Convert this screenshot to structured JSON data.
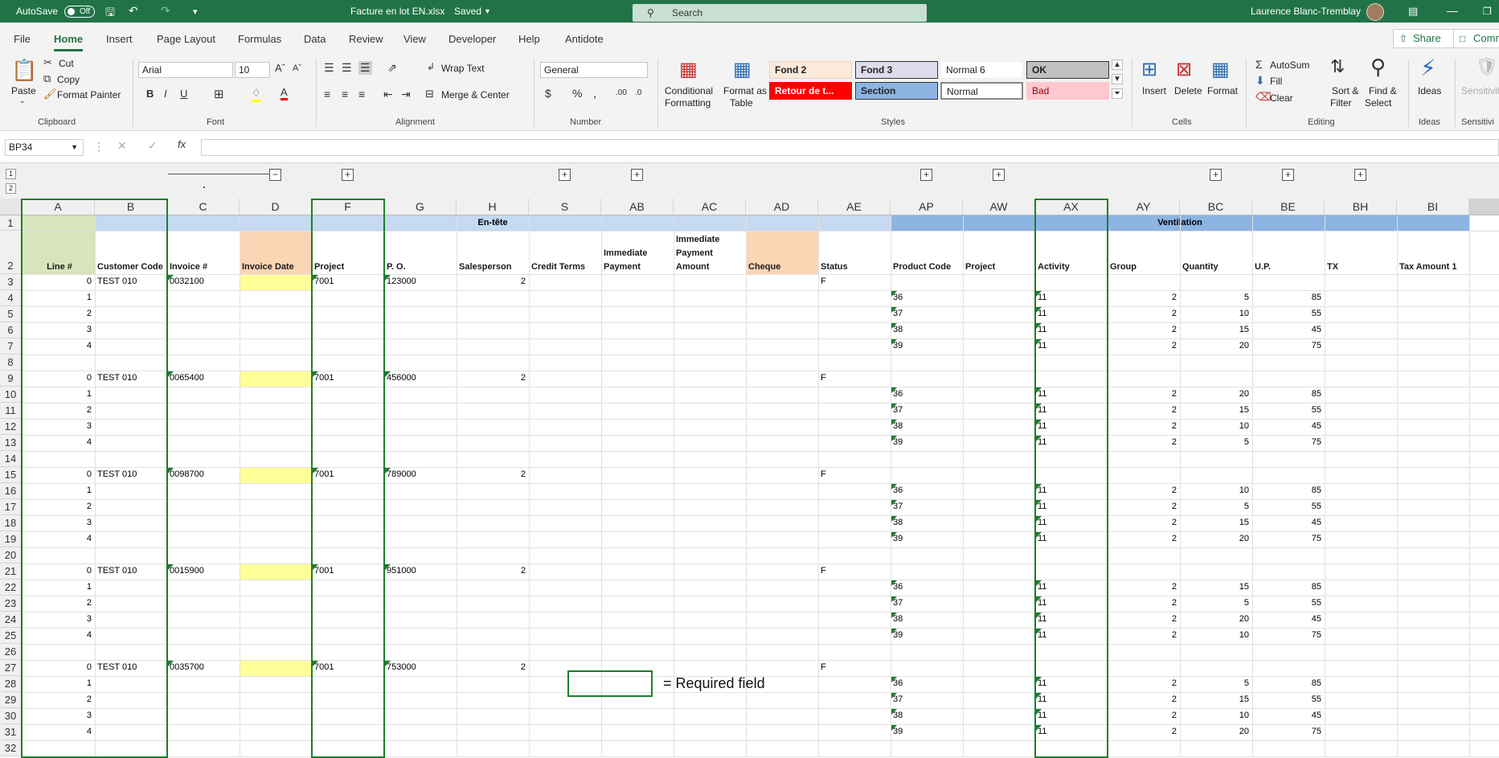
{
  "titlebar": {
    "autosave_label": "AutoSave",
    "autosave_state": "Off",
    "file": "Facture en lot EN.xlsx",
    "file_status": "Saved",
    "search_placeholder": "Search",
    "user": "Laurence Blanc-Tremblay"
  },
  "tabs": [
    "File",
    "Home",
    "Insert",
    "Page Layout",
    "Formulas",
    "Data",
    "Review",
    "View",
    "Developer",
    "Help",
    "Antidote"
  ],
  "share_label": "Share",
  "comments_label": "Comm",
  "ribbon": {
    "paste": "Paste",
    "cut": "Cut",
    "copy": "Copy",
    "format_painter": "Format Painter",
    "clipboard": "Clipboard",
    "font_name": "Arial",
    "font_size": "10",
    "font_group": "Font",
    "wrap_text": "Wrap Text",
    "merge_center": "Merge & Center",
    "alignment": "Alignment",
    "number_format": "General",
    "number_group": "Number",
    "cond_format_1": "Conditional",
    "cond_format_2": "Formatting",
    "format_table_1": "Format as",
    "format_table_2": "Table",
    "styles": "Styles",
    "style_items": [
      "Fond 2",
      "Fond 3",
      "Normal 6",
      "OK",
      "Retour de t...",
      "Section",
      "Normal",
      "Bad"
    ],
    "insert": "Insert",
    "delete": "Delete",
    "format": "Format",
    "cells": "Cells",
    "autosum": "AutoSum",
    "fill": "Fill",
    "clear": "Clear",
    "sort_filter_1": "Sort &",
    "sort_filter_2": "Filter",
    "find_select_1": "Find &",
    "find_select_2": "Select",
    "editing": "Editing",
    "ideas": "Ideas",
    "ideas_group": "Ideas",
    "sensitivity": "Sensitivit",
    "sensitivity_group": "Sensitivi"
  },
  "formula_bar": {
    "name_box": "BP34",
    "formula": ""
  },
  "outline_levels": [
    "1",
    "2"
  ],
  "columns": [
    "A",
    "B",
    "C",
    "D",
    "F",
    "G",
    "H",
    "S",
    "AB",
    "AC",
    "AD",
    "AE",
    "AP",
    "AW",
    "AX",
    "AY",
    "BC",
    "BE",
    "BH",
    "BI"
  ],
  "band_headers": {
    "entete": "En-tête",
    "ventilation": "Ventilation"
  },
  "headers": [
    "Line #",
    "Customer Code",
    "Invoice #",
    "Invoice Date",
    "Project",
    "P. O.",
    "Salesperson",
    "Credit Terms",
    "Immediate Payment",
    "Immediate Payment Amount",
    "Cheque",
    "Status",
    "Product Code",
    "Project",
    "Activity",
    "Group",
    "Quantity",
    "U.P.",
    "TX",
    "Tax Amount 1"
  ],
  "row_numbers": [
    "1",
    "2",
    "3",
    "4",
    "5",
    "6",
    "7",
    "8",
    "9",
    "10",
    "11",
    "12",
    "13",
    "14",
    "15",
    "16",
    "17",
    "18",
    "19",
    "20",
    "21",
    "22",
    "23",
    "24",
    "25",
    "26",
    "27",
    "28",
    "29",
    "30",
    "31",
    "32"
  ],
  "invoices": [
    {
      "customer": "TEST 010",
      "invoice": "0032100",
      "project": "7001",
      "po": "123000",
      "salesperson": "2",
      "status": "F",
      "lines": [
        {
          "n": "1",
          "product": "36",
          "activity": "11",
          "group": "2",
          "qty": "5",
          "up": "85"
        },
        {
          "n": "2",
          "product": "37",
          "activity": "11",
          "group": "2",
          "qty": "10",
          "up": "55"
        },
        {
          "n": "3",
          "product": "38",
          "activity": "11",
          "group": "2",
          "qty": "15",
          "up": "45"
        },
        {
          "n": "4",
          "product": "39",
          "activity": "11",
          "group": "2",
          "qty": "20",
          "up": "75"
        }
      ]
    },
    {
      "customer": "TEST 010",
      "invoice": "0065400",
      "project": "7001",
      "po": "456000",
      "salesperson": "2",
      "status": "F",
      "lines": [
        {
          "n": "1",
          "product": "36",
          "activity": "11",
          "group": "2",
          "qty": "20",
          "up": "85"
        },
        {
          "n": "2",
          "product": "37",
          "activity": "11",
          "group": "2",
          "qty": "15",
          "up": "55"
        },
        {
          "n": "3",
          "product": "38",
          "activity": "11",
          "group": "2",
          "qty": "10",
          "up": "45"
        },
        {
          "n": "4",
          "product": "39",
          "activity": "11",
          "group": "2",
          "qty": "5",
          "up": "75"
        }
      ]
    },
    {
      "customer": "TEST 010",
      "invoice": "0098700",
      "project": "7001",
      "po": "789000",
      "salesperson": "2",
      "status": "F",
      "lines": [
        {
          "n": "1",
          "product": "36",
          "activity": "11",
          "group": "2",
          "qty": "10",
          "up": "85"
        },
        {
          "n": "2",
          "product": "37",
          "activity": "11",
          "group": "2",
          "qty": "5",
          "up": "55"
        },
        {
          "n": "3",
          "product": "38",
          "activity": "11",
          "group": "2",
          "qty": "15",
          "up": "45"
        },
        {
          "n": "4",
          "product": "39",
          "activity": "11",
          "group": "2",
          "qty": "20",
          "up": "75"
        }
      ]
    },
    {
      "customer": "TEST 010",
      "invoice": "0015900",
      "project": "7001",
      "po": "951000",
      "salesperson": "2",
      "status": "F",
      "lines": [
        {
          "n": "1",
          "product": "36",
          "activity": "11",
          "group": "2",
          "qty": "15",
          "up": "85"
        },
        {
          "n": "2",
          "product": "37",
          "activity": "11",
          "group": "2",
          "qty": "5",
          "up": "55"
        },
        {
          "n": "3",
          "product": "38",
          "activity": "11",
          "group": "2",
          "qty": "20",
          "up": "45"
        },
        {
          "n": "4",
          "product": "39",
          "activity": "11",
          "group": "2",
          "qty": "10",
          "up": "75"
        }
      ]
    },
    {
      "customer": "TEST 010",
      "invoice": "0035700",
      "project": "7001",
      "po": "753000",
      "salesperson": "2",
      "status": "F",
      "lines": [
        {
          "n": "1",
          "product": "36",
          "activity": "11",
          "group": "2",
          "qty": "5",
          "up": "85"
        },
        {
          "n": "2",
          "product": "37",
          "activity": "11",
          "group": "2",
          "qty": "15",
          "up": "55"
        },
        {
          "n": "3",
          "product": "38",
          "activity": "11",
          "group": "2",
          "qty": "10",
          "up": "45"
        },
        {
          "n": "4",
          "product": "39",
          "activity": "11",
          "group": "2",
          "qty": "20",
          "up": "75"
        }
      ]
    }
  ],
  "invoice_line_number": "0",
  "legend_text": "= Required field",
  "colors": {
    "excel_green": "#217346",
    "required_border": "#1b7f2a",
    "entete_band": "#c5d9f1",
    "ventilation_band": "#8db4e2",
    "line_col": "#d8e4bc",
    "invoice_date_hdr": "#fcd5b4",
    "cheque_hdr": "#fcd5b4",
    "date_cell": "#ffff99"
  }
}
